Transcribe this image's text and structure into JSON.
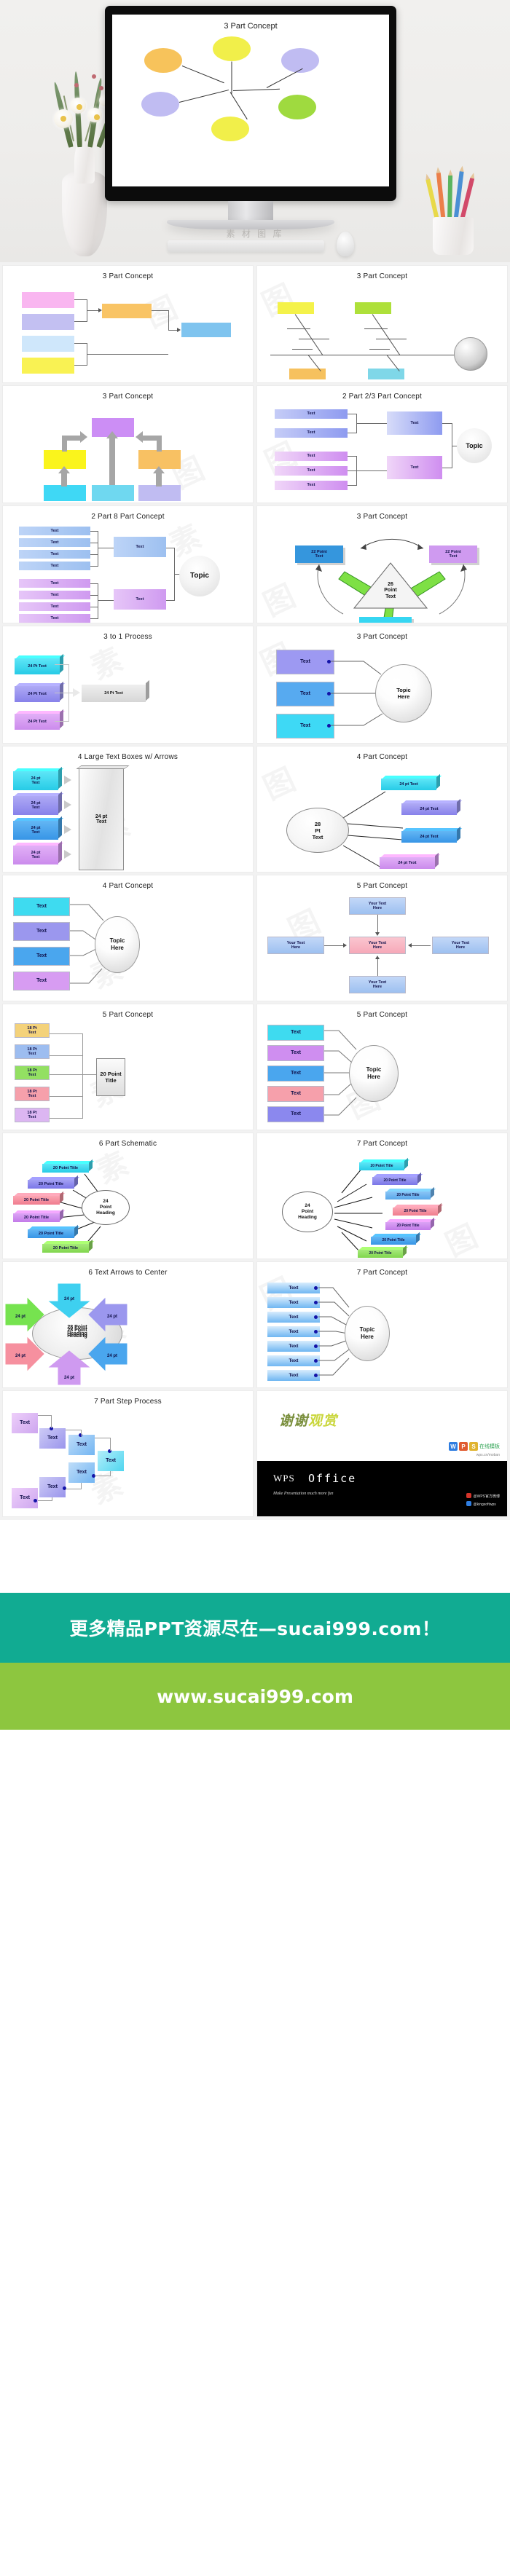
{
  "hero": {
    "slide_title": "3 Part Concept",
    "caption": "素 材 图 库",
    "bubble_colors": [
      "#f7c35b",
      "#f1ef4a",
      "#b9b4ef",
      "#9fda3f",
      "#f7c35b",
      "#f1ef4a"
    ]
  },
  "slides": [
    {
      "id": "slide-3-part-concept-boxes",
      "title": "3 Part Concept",
      "type": "cascade-boxes",
      "boxes": [
        {
          "label": "",
          "color": "#f9b6f0"
        },
        {
          "label": "",
          "color": "#c3c0f2"
        },
        {
          "label": "",
          "color": "#cfe7fb"
        },
        {
          "label": "",
          "color": "#f9f253"
        }
      ],
      "mid": {
        "label": "",
        "color": "#f9c465"
      },
      "out": {
        "label": "",
        "color": "#7fc4ef"
      }
    },
    {
      "id": "slide-3-part-fishbone",
      "title": "3 Part Concept",
      "type": "fishbone",
      "heads": [
        {
          "color": "#f4f24a"
        },
        {
          "color": "#aee03a"
        },
        {
          "color": "#f6c15e"
        },
        {
          "color": "#7fd7e8"
        }
      ]
    },
    {
      "id": "slide-3-part-arrows-up",
      "title": "3 Part Concept",
      "type": "arrows-up",
      "top": {
        "color": "#cc8ef5"
      },
      "mid": [
        {
          "color": "#faf41c"
        },
        {
          "color": "#f8c163"
        }
      ],
      "bottom": [
        {
          "color": "#3fd8f5"
        },
        {
          "color": "#6fd8f0"
        },
        {
          "color": "#c0bcf2"
        }
      ]
    },
    {
      "id": "slide-2-part-2-3-part-concept",
      "title": "2 Part 2/3 Part Concept",
      "type": "tree-2-3",
      "topic_label": "Topic",
      "leaf_label": "Text",
      "node_label": "Text",
      "group_colors": [
        "#8e9bf0",
        "#cf8ef0"
      ]
    },
    {
      "id": "slide-2-part-8-part-concept",
      "title": "2 Part 8 Part Concept",
      "type": "tree-8",
      "topic_label": "Topic",
      "leaf_label": "Text",
      "node_label": "Text",
      "group_colors": [
        "#9dc0f0",
        "#cf9af0"
      ]
    },
    {
      "id": "slide-3-part-cycle",
      "title": "3 Part Concept",
      "type": "cycle-triangle",
      "center_label": "26\nPoint\nText",
      "nodes": [
        {
          "label": "22 Point\nText",
          "color": "#3596dd"
        },
        {
          "label": "22 Point\nText",
          "color": "#cf9af0"
        },
        {
          "label": "22 Point\nText",
          "color": "#36d6f2"
        }
      ]
    },
    {
      "id": "slide-3-to-1-process",
      "title": "3 to 1 Process",
      "type": "three-to-one",
      "inputs": [
        {
          "label": "24 Pt Text",
          "color": "#3edbf0"
        },
        {
          "label": "24 Pt Text",
          "color": "#9b97ee"
        },
        {
          "label": "24 Pt Text",
          "color": "#d79cf2"
        }
      ],
      "output": {
        "label": "24 Pt Text",
        "color": "#e2e2e2"
      }
    },
    {
      "id": "slide-3-part-topic-here",
      "title": "3 Part Concept",
      "type": "boxes-to-ellipse",
      "topic_label": "Topic\nHere",
      "boxes": [
        {
          "label": "Text",
          "color": "#9d99f2"
        },
        {
          "label": "Text",
          "color": "#57aaf0"
        },
        {
          "label": "Text",
          "color": "#3ed9f5"
        }
      ]
    },
    {
      "id": "slide-4-large-text-boxes-arrows",
      "title": "4 Large Text Boxes w/ Arrows",
      "type": "four-arrows-slab",
      "slab_label": "24 pt\nText",
      "boxes": [
        {
          "label": "24 pt\nText",
          "color": "#3edbf0"
        },
        {
          "label": "24 pt\nText",
          "color": "#9b97ee"
        },
        {
          "label": "24 pt\nText",
          "color": "#4aa6ee"
        },
        {
          "label": "24 pt\nText",
          "color": "#d79cf2"
        }
      ]
    },
    {
      "id": "slide-4-part-concept-ellipse",
      "title": "4 Part Concept",
      "type": "ellipse-radial-4",
      "center_label": "28\nPt\nText",
      "boxes": [
        {
          "label": "24 pt Text",
          "color": "#3edbf0"
        },
        {
          "label": "24 pt Text",
          "color": "#9b97ee"
        },
        {
          "label": "24 pt Text",
          "color": "#4aa6ee"
        },
        {
          "label": "24 pt Text",
          "color": "#d79cf2"
        }
      ]
    },
    {
      "id": "slide-4-part-topic-here",
      "title": "4 Part Concept",
      "type": "boxes-to-ellipse",
      "topic_label": "Topic\nHere",
      "boxes": [
        {
          "label": "Text",
          "color": "#3edbf0"
        },
        {
          "label": "Text",
          "color": "#9b97ee"
        },
        {
          "label": "Text",
          "color": "#4aa6ee"
        },
        {
          "label": "Text",
          "color": "#d79cf2"
        }
      ]
    },
    {
      "id": "slide-5-part-cross",
      "title": "5 Part Concept",
      "type": "cross-5",
      "center": {
        "label": "Your Text\nHere",
        "color": "#f6a8b8"
      },
      "arms": [
        {
          "label": "Your Text\nHere",
          "color": "#9dc0f0"
        },
        {
          "label": "Your Text\nHere",
          "color": "#9dc0f0"
        },
        {
          "label": "Your Text\nHere",
          "color": "#9dc0f0"
        },
        {
          "label": "Your Text\nHere",
          "color": "#9dc0f0"
        }
      ]
    },
    {
      "id": "slide-5-part-20-point-title",
      "title": "5 Part Concept",
      "type": "five-to-title",
      "target_label": "20 Point\nTitle",
      "boxes": [
        {
          "label": "18 Pt\nText",
          "color": "#f4d27a"
        },
        {
          "label": "18 Pt\nText",
          "color": "#9dbdf0"
        },
        {
          "label": "18 Pt\nText",
          "color": "#93e062"
        },
        {
          "label": "18 Pt\nText",
          "color": "#f6a0ab"
        },
        {
          "label": "18 Pt\nText",
          "color": "#dcb6f2"
        }
      ]
    },
    {
      "id": "slide-5-part-topic-here",
      "title": "5 Part Concept",
      "type": "boxes-to-ellipse",
      "topic_label": "Topic\nHere",
      "boxes": [
        {
          "label": "Text",
          "color": "#3edbf0"
        },
        {
          "label": "Text",
          "color": "#cf8ef0"
        },
        {
          "label": "Text",
          "color": "#4aa6ee"
        },
        {
          "label": "Text",
          "color": "#f6a0ab"
        },
        {
          "label": "Text",
          "color": "#8b88ee"
        }
      ]
    },
    {
      "id": "slide-6-part-schematic",
      "title": "6 Part Schematic",
      "type": "radial-left-6",
      "center_label": "24\nPoint\nHeading",
      "boxes": [
        {
          "label": "20 Point Title",
          "color": "#3edbf0"
        },
        {
          "label": "20 Point Title",
          "color": "#8b88ee"
        },
        {
          "label": "20 Point Title",
          "color": "#f6909f"
        },
        {
          "label": "20 Point Title",
          "color": "#cf8ef0"
        },
        {
          "label": "20 Point Title",
          "color": "#4aa6ee"
        },
        {
          "label": "20 Point Title",
          "color": "#93e062"
        }
      ]
    },
    {
      "id": "slide-7-part-concept-radial",
      "title": "7 Part Concept",
      "type": "radial-right-7",
      "center_label": "24\nPoint\nHeading",
      "boxes": [
        {
          "label": "20 Point Title",
          "color": "#3edbf0"
        },
        {
          "label": "20 Point Title",
          "color": "#8b88ee"
        },
        {
          "label": "20 Point Title",
          "color": "#6fb6f2"
        },
        {
          "label": "20 Point Title",
          "color": "#f6909f"
        },
        {
          "label": "20 Point Title",
          "color": "#cf8ef0"
        },
        {
          "label": "20 Point Title",
          "color": "#4aa6ee"
        },
        {
          "label": "20 Point Title",
          "color": "#93e062"
        }
      ]
    },
    {
      "id": "slide-6-text-arrows-to-center",
      "title": "6 Text Arrows to Center",
      "type": "arrows-to-center-6",
      "center_label": "28 Point\nHeading",
      "arrows": [
        {
          "label": "24 pt",
          "color": "#3ed0f0",
          "dir": "down"
        },
        {
          "label": "24 pt",
          "color": "#9b97ee",
          "dir": "left"
        },
        {
          "label": "24 pt",
          "color": "#4aa6ee",
          "dir": "left"
        },
        {
          "label": "24 pt",
          "color": "#cf9af0",
          "dir": "up"
        },
        {
          "label": "24 pt",
          "color": "#f6909f",
          "dir": "right"
        },
        {
          "label": "24 pt",
          "color": "#76e34f",
          "dir": "right"
        }
      ]
    },
    {
      "id": "slide-7-part-topic-here",
      "title": "7 Part Concept",
      "type": "boxes-to-ellipse-7",
      "topic_label": "Topic\nHere",
      "leaf_label": "Text",
      "box_color": "#6fb6f2"
    },
    {
      "id": "slide-7-part-step-process",
      "title": "7 Part Step Process",
      "type": "step-process-7",
      "leaf_label": "Text",
      "step_colors": [
        "#dcaaf2",
        "#a09af0",
        "#6fb6f2",
        "#56d8ef",
        "#6fb6f2",
        "#a09af0",
        "#dcaaf2"
      ]
    }
  ],
  "thank_you": {
    "cn_part1": "谢谢",
    "cn_part2": "观赏",
    "wps_w": "W",
    "wps_p": "P",
    "wps_s": "S",
    "wps_online": "在线模板",
    "wps_url": "wps.cn/moban",
    "band_brand": "WPS",
    "band_product": "Office",
    "band_tagline": "Make Presentation much more fun",
    "social_1": "@WPS官方微博",
    "social_2": "@kingsoftwps"
  },
  "footer": {
    "banner_teal": "更多精品PPT资源尽在—sucai999.com！",
    "banner_green": "www.sucai999.com",
    "teal_color": "#11ab92",
    "green_color": "#8dc63f"
  },
  "watermark": "素鸟图库"
}
